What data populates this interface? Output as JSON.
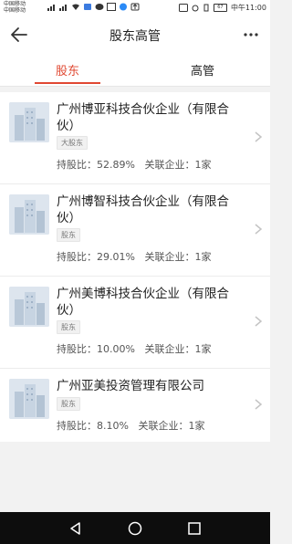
{
  "status_bar": {
    "carrier_1": "中国移动",
    "carrier_2": "中国移动",
    "battery": "67",
    "time": "中午11:00"
  },
  "header": {
    "title": "股东高管"
  },
  "tabs": [
    {
      "label": "股东",
      "active": true
    },
    {
      "label": "高管",
      "active": false
    }
  ],
  "shareholders": [
    {
      "name": "广州博亚科技合伙企业（有限合伙）",
      "tag": "大股东",
      "share_label": "持股比：",
      "share_value": "52.89%",
      "related_label": "关联企业：",
      "related_value": "1家"
    },
    {
      "name": "广州博智科技合伙企业（有限合伙）",
      "tag": "股东",
      "share_label": "持股比：",
      "share_value": "29.01%",
      "related_label": "关联企业：",
      "related_value": "1家"
    },
    {
      "name": "广州美博科技合伙企业（有限合伙）",
      "tag": "股东",
      "share_label": "持股比：",
      "share_value": "10.00%",
      "related_label": "关联企业：",
      "related_value": "1家"
    },
    {
      "name": "广州亚美投资管理有限公司",
      "tag": "股东",
      "share_label": "持股比：",
      "share_value": "8.10%",
      "related_label": "关联企业：",
      "related_value": "1家"
    }
  ],
  "icons": {
    "back": "arrow-left-icon",
    "more": "more-icon",
    "chevron": "chevron-right-icon",
    "company": "building-icon",
    "nav_back": "triangle-back-icon",
    "nav_home": "circle-home-icon",
    "nav_recent": "square-recent-icon"
  },
  "colors": {
    "accent": "#e04832",
    "background": "#f2f2f2",
    "navbar": "#0d0d0d"
  }
}
